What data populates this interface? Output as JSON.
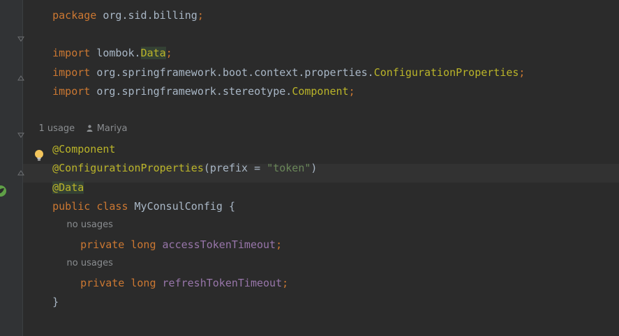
{
  "code": {
    "package_line": "package org.sid.billing;",
    "imports": [
      {
        "keyword": "import",
        "path": "lombok.",
        "name": "Data",
        "end": ";"
      },
      {
        "keyword": "import",
        "path": "org.springframework.boot.context.properties.",
        "name": "ConfigurationProperties",
        "end": ";"
      },
      {
        "keyword": "import",
        "path": "org.springframework.stereotype.",
        "name": "Component",
        "end": ";"
      }
    ],
    "class_hint": {
      "usage": "1 usage",
      "author": "Mariya"
    },
    "annotations": {
      "component": "@Component",
      "config_at": "@",
      "config_name": "ConfigurationProperties",
      "config_args_open": "(prefix = ",
      "config_value": "\"token\"",
      "config_args_close": ")",
      "data": "@Data"
    },
    "class_decl": {
      "modifier": "public",
      "keyword": "class",
      "name": "MyConsulConfig",
      "brace": " {"
    },
    "fields": [
      {
        "hint": "no usages",
        "modifier": "private",
        "type": "long",
        "name": "accessTokenTimeout",
        "end": ";"
      },
      {
        "hint": "no usages",
        "modifier": "private",
        "type": "long",
        "name": "refreshTokenTimeout",
        "end": ";"
      }
    ],
    "closing_brace": "}"
  },
  "colors": {
    "background": "#2b2b2b",
    "keyword": "#cc7832",
    "annotation": "#bbb529",
    "string": "#6a8759",
    "field": "#9876aa",
    "text": "#a9b7c6",
    "hint": "#8a8d90"
  },
  "icons": {
    "fold": "fold-icon",
    "intention": "lightbulb-icon",
    "gutter_bean": "spring-bean-icon",
    "author": "person-icon"
  }
}
